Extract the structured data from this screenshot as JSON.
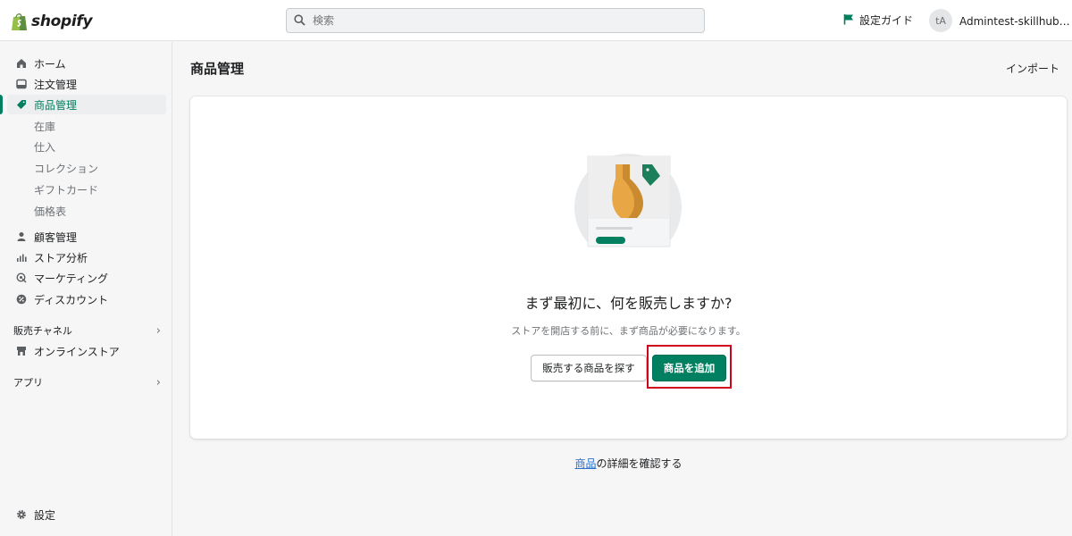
{
  "topbar": {
    "logo_text": "shopify",
    "search_placeholder": "検索",
    "setup_guide": "設定ガイド",
    "avatar_initials": "tA",
    "account_name": "Admintest-skillhubスト..."
  },
  "sidebar": {
    "items": [
      {
        "label": "ホーム",
        "icon": "home-icon"
      },
      {
        "label": "注文管理",
        "icon": "inbox-icon"
      },
      {
        "label": "商品管理",
        "icon": "tag-icon",
        "active": true
      },
      {
        "label": "顧客管理",
        "icon": "person-icon"
      },
      {
        "label": "ストア分析",
        "icon": "bar-chart-icon"
      },
      {
        "label": "マーケティング",
        "icon": "target-icon"
      },
      {
        "label": "ディスカウント",
        "icon": "discount-icon"
      }
    ],
    "product_subitems": [
      "在庫",
      "仕入",
      "コレクション",
      "ギフトカード",
      "価格表"
    ],
    "sales_channels_label": "販売チャネル",
    "online_store": "オンラインストア",
    "apps_label": "アプリ",
    "settings": "設定"
  },
  "main": {
    "title": "商品管理",
    "import": "インポート",
    "empty_heading": "まず最初に、何を販売しますか?",
    "empty_sub": "ストアを開店する前に、まず商品が必要になります。",
    "find_products_button": "販売する商品を探す",
    "add_product_button": "商品を追加",
    "learn_link": "商品",
    "learn_suffix": "の詳細を確認する"
  },
  "colors": {
    "accent": "#008060",
    "highlight_border": "#d0021b",
    "link": "#2c6ecb"
  }
}
